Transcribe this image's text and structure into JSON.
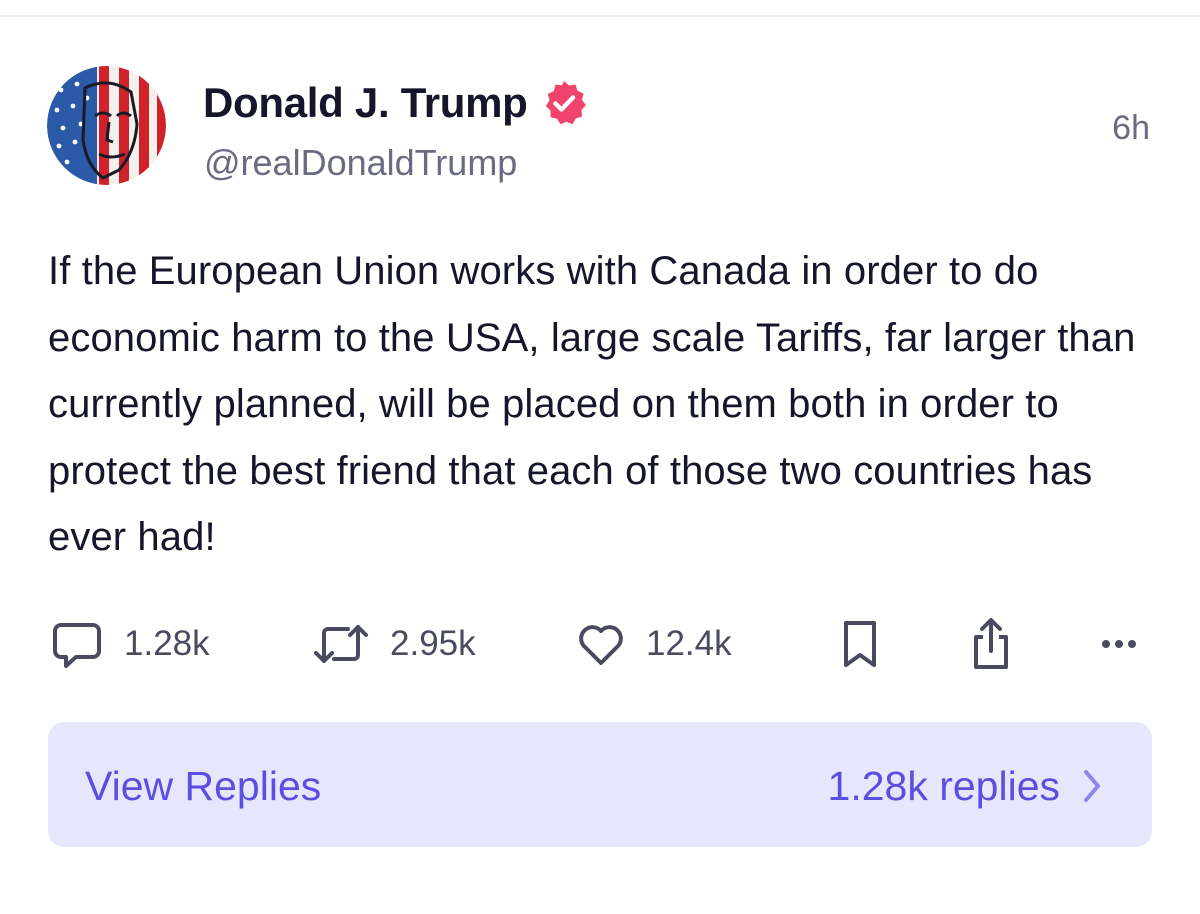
{
  "post": {
    "author": {
      "display_name": "Donald J. Trump",
      "handle": "@realDonaldTrump",
      "verified_icon": "verified-badge-icon"
    },
    "time_ago": "6h",
    "text": "If the European Union works with Canada in order to do economic harm to the USA, large scale Tariffs, far larger than currently planned, will be placed on them both in order to protect the best friend that each of those two countries has ever had!"
  },
  "actions": {
    "reply": {
      "icon": "comment-icon",
      "count": "1.28k"
    },
    "repost": {
      "icon": "repost-icon",
      "count": "2.95k"
    },
    "like": {
      "icon": "heart-icon",
      "count": "12.4k"
    },
    "bookmark": {
      "icon": "bookmark-icon"
    },
    "share": {
      "icon": "share-icon"
    },
    "more": {
      "icon": "more-dots-icon"
    }
  },
  "replies_bar": {
    "label": "View Replies",
    "count_text": "1.28k replies",
    "chevron_icon": "chevron-right-icon"
  },
  "colors": {
    "text": "#16162a",
    "muted": "#6b6b80",
    "icon": "#4b4b60",
    "accent": "#5a4fe0",
    "replies_bg": "#e6e7fc",
    "verified": "#f0446c"
  }
}
